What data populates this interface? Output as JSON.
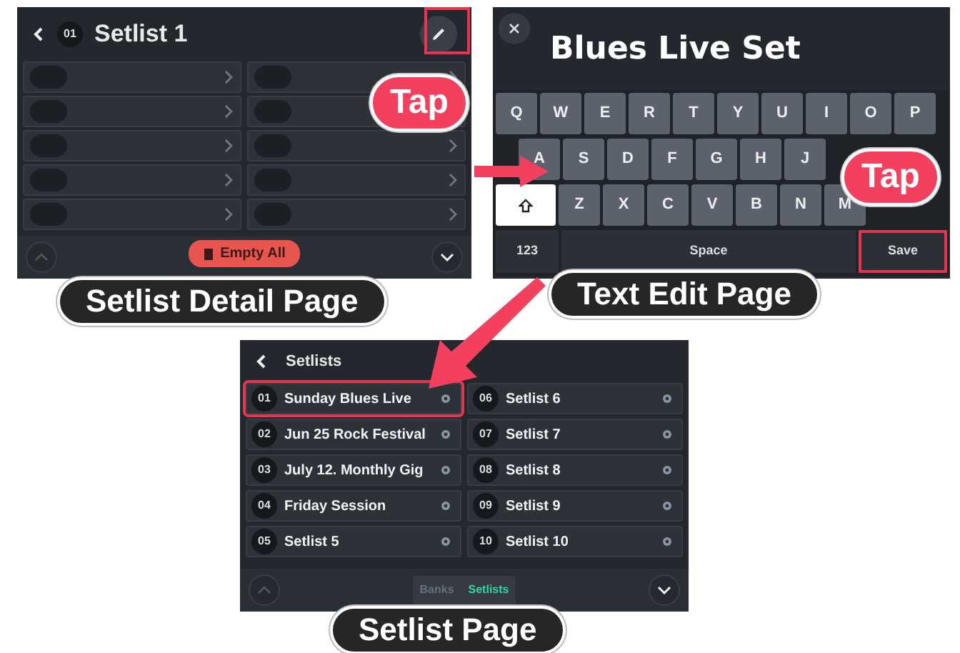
{
  "detail_page": {
    "number": "01",
    "title": "Setlist 1",
    "slots": [
      {
        "filled": false
      },
      {
        "filled": false
      },
      {
        "filled": false
      },
      {
        "filled": false
      },
      {
        "filled": false
      },
      {
        "filled": false
      },
      {
        "filled": false
      },
      {
        "filled": false
      },
      {
        "filled": false
      },
      {
        "filled": false
      }
    ],
    "empty_button": "Empty All",
    "callout": "Tap",
    "caption": "Setlist Detail Page"
  },
  "text_edit_page": {
    "title": "Blues Live Set",
    "key_rows": [
      [
        "Q",
        "W",
        "E",
        "R",
        "T",
        "Y",
        "U",
        "I",
        "O",
        "P"
      ],
      [
        "A",
        "S",
        "D",
        "F",
        "G",
        "H",
        "J"
      ],
      [
        "Z",
        "X",
        "C",
        "V",
        "B",
        "N",
        "M"
      ]
    ],
    "shift_on": true,
    "mode_key": "123",
    "space_key": "Space",
    "save_key": "Save",
    "callout": "Tap",
    "caption": "Text Edit Page"
  },
  "setlist_page": {
    "title": "Setlists",
    "items": [
      {
        "number": "01",
        "name": "Sunday Blues Live",
        "highlighted": true
      },
      {
        "number": "02",
        "name": "Jun 25 Rock Festival",
        "highlighted": false
      },
      {
        "number": "03",
        "name": "July 12. Monthly Gig",
        "highlighted": false
      },
      {
        "number": "04",
        "name": "Friday Session",
        "highlighted": false
      },
      {
        "number": "05",
        "name": "Setlist 5",
        "highlighted": false
      },
      {
        "number": "06",
        "name": "Setlist 6",
        "highlighted": false
      },
      {
        "number": "07",
        "name": "Setlist 7",
        "highlighted": false
      },
      {
        "number": "08",
        "name": "Setlist 8",
        "highlighted": false
      },
      {
        "number": "09",
        "name": "Setlist 9",
        "highlighted": false
      },
      {
        "number": "10",
        "name": "Setlist 10",
        "highlighted": false
      }
    ],
    "tabs": [
      {
        "label": "Banks",
        "selected": false
      },
      {
        "label": "Setlists",
        "selected": true
      }
    ],
    "caption": "Setlist Page"
  }
}
